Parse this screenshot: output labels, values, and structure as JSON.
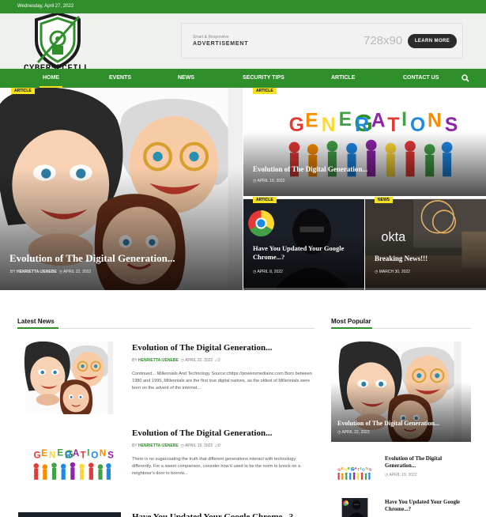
{
  "topbar": {
    "date": "Wednesday, April 27, 2022"
  },
  "logo": {
    "text": "CYBERSECFILL"
  },
  "ad": {
    "small": "Smart & Responsive",
    "big": "ADVERTISEMENT",
    "size": "728x90",
    "button": "LEARN MORE"
  },
  "nav": {
    "items": [
      "HOME",
      "EVENTS",
      "NEWS",
      "SECURITY TIPS",
      "ARTICLE",
      "CONTACT US"
    ],
    "search_icon": "search-icon"
  },
  "hero": {
    "main": {
      "badge": "ARTICLE",
      "title": "Evolution of The Digital Generation...",
      "author": "HENRIETTA IJENEBE",
      "date": "APRIL 22, 2022"
    },
    "top_right": {
      "badge": "ARTICLE",
      "title": "Evolution of The Digital Generation...",
      "date": "APRIL 19, 2022",
      "word": "GENERATIONS"
    },
    "bottom_left": {
      "badge": "ARTICLE",
      "title": "Have You Updated Your Google Chrome...?",
      "date": "APRIL 8, 2022"
    },
    "bottom_right": {
      "badge": "NEWS",
      "title": "Breaking News!!!",
      "date": "MARCH 30, 2022",
      "logo": "okta"
    }
  },
  "latest": {
    "heading": "Latest News",
    "posts": [
      {
        "title": "Evolution of The Digital Generation...",
        "author": "HENRIETTA IJENEBE",
        "date": "APRIL 22, 2022",
        "comments": "2",
        "excerpt": "Continued... Millennials And Technology Source:chttps://powersmediainc.com Born between 1980 and 1995, Millennials are the first true digital natives, as the oldest of Millennials were born on the advent of the internet..."
      },
      {
        "title": "Evolution of The Digital Generation...",
        "author": "HENRIETTA IJENEBE",
        "date": "APRIL 19, 2022",
        "comments": "0",
        "excerpt": "There is no sugarcoating the truth that different generations interact with technology differently. For a sweet comparison, consider how it used to be the norm to knock on a neighbour's door to borrow..."
      },
      {
        "title": "Have You Updated Your Google Chrome...?"
      }
    ]
  },
  "popular": {
    "heading": "Most Popular",
    "featured": {
      "title": "Evolution of The Digital Generation...",
      "date": "APRIL 22, 2022"
    },
    "items": [
      {
        "title": "Evolution of The Digital Generation...",
        "date": "APRIL 19, 2022"
      },
      {
        "title": "Have You Updated Your Google Chrome...?"
      }
    ]
  },
  "colors": {
    "brand_green": "#2f8f2a",
    "badge_yellow": "#f5e21b"
  }
}
